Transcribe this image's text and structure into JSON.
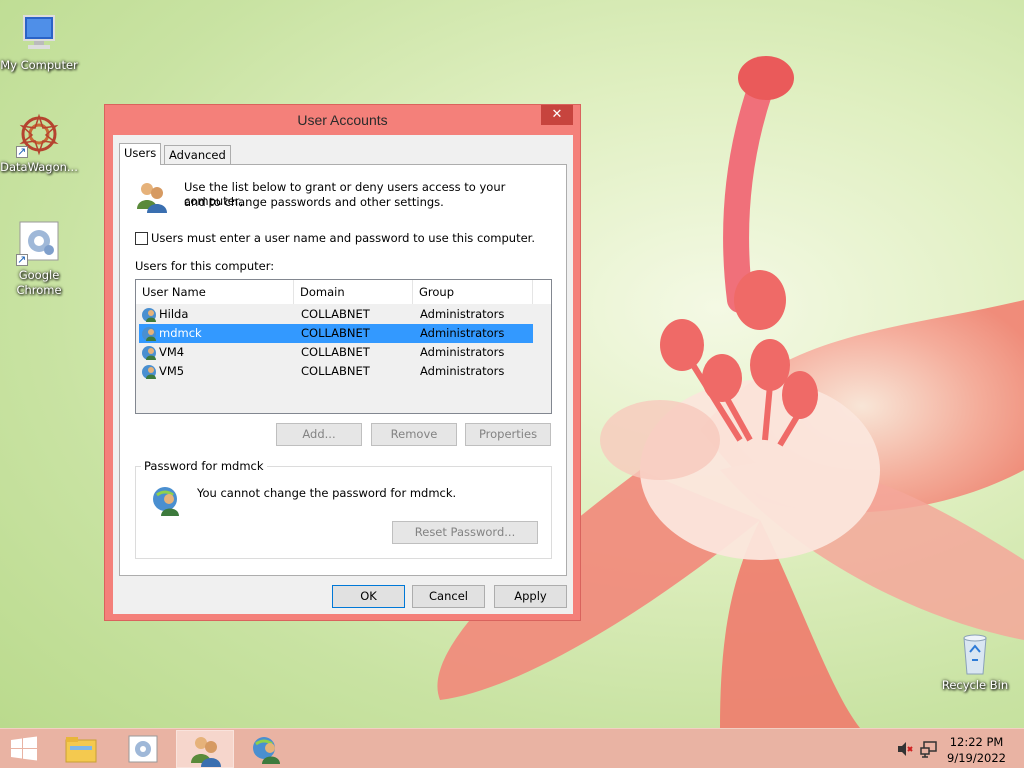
{
  "desktop": {
    "icons": [
      {
        "label": "My Computer",
        "icon": "computer-icon"
      },
      {
        "label": "DataWagon...",
        "icon": "datawagon-icon"
      },
      {
        "label": "Google Chrome",
        "icon": "chrome-shortcut-icon"
      },
      {
        "label": "Recycle Bin",
        "icon": "recycle-bin-icon"
      }
    ]
  },
  "dialog": {
    "title": "User Accounts",
    "close_glyph": "✕",
    "tabs": [
      {
        "label": "Users",
        "active": true
      },
      {
        "label": "Advanced",
        "active": false
      }
    ],
    "intro_text_line1": "Use the list below to grant or deny users access to your computer,",
    "intro_text_line2": "and to change passwords and other settings.",
    "must_login_label": "Users must enter a user name and password to use this computer.",
    "must_login_checked": false,
    "users_label": "Users for this computer:",
    "columns": [
      "User Name",
      "Domain",
      "Group"
    ],
    "users": [
      {
        "name": "Hilda",
        "domain": "COLLABNET",
        "group": "Administrators",
        "selected": false
      },
      {
        "name": "mdmck",
        "domain": "COLLABNET",
        "group": "Administrators",
        "selected": true
      },
      {
        "name": "VM4",
        "domain": "COLLABNET",
        "group": "Administrators",
        "selected": false
      },
      {
        "name": "VM5",
        "domain": "COLLABNET",
        "group": "Administrators",
        "selected": false
      }
    ],
    "buttons": {
      "add": "Add...",
      "remove": "Remove",
      "properties": "Properties",
      "reset_password": "Reset Password...",
      "ok": "OK",
      "cancel": "Cancel",
      "apply": "Apply"
    },
    "password_group_label": "Password for mdmck",
    "password_message": "You cannot change the password for mdmck."
  },
  "taskbar": {
    "items": [
      "start-button",
      "file-explorer-icon",
      "control-panel-icon",
      "user-accounts-icon",
      "network-users-icon"
    ],
    "clock_time": "12:22 PM",
    "clock_date": "9/19/2022"
  },
  "colors": {
    "window_frame": "#f4807a",
    "selection": "#3399ff",
    "taskbar": "#e9b3a3"
  }
}
